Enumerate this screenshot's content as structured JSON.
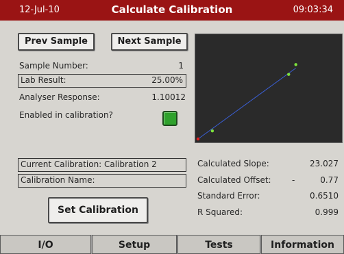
{
  "header": {
    "date": "12-Jul-10",
    "title": "Calculate Calibration",
    "time": "09:03:34"
  },
  "buttons": {
    "prev": "Prev Sample",
    "next": "Next Sample",
    "set": "Set Calibration"
  },
  "sample": {
    "number_label": "Sample Number:",
    "number_value": "1",
    "lab_label": "Lab Result:",
    "lab_value": "25.00%",
    "response_label": "Analyser Response:",
    "response_value": "1.10012",
    "enabled_label": "Enabled in calibration?",
    "enabled": true
  },
  "calibration": {
    "current": "Current Calibration: Calibration 2",
    "name_label": "Calibration Name:"
  },
  "stats": [
    {
      "label": "Calculated Slope:",
      "sign": "",
      "value": "23.027"
    },
    {
      "label": "Calculated Offset:",
      "sign": "-",
      "value": "0.77"
    },
    {
      "label": "Standard Error:",
      "sign": "",
      "value": "0.6510"
    },
    {
      "label": "R Squared:",
      "sign": "",
      "value": "0.999"
    }
  ],
  "tabs": [
    "I/O",
    "Setup",
    "Tests",
    "Information"
  ],
  "colors": {
    "titlebar": "#9a1414",
    "plot_bg": "#2a2a2a",
    "fit_line": "#3a5fd6",
    "point": "#7ee23c",
    "current_point": "#e02020",
    "led_on": "#2fa12c"
  },
  "chart_data": {
    "type": "scatter",
    "points": [
      {
        "x": 0.0,
        "y": 0.0,
        "current": true
      },
      {
        "x": 0.12,
        "y": 0.09
      },
      {
        "x": 0.76,
        "y": 0.72
      },
      {
        "x": 0.82,
        "y": 0.83
      }
    ],
    "fit_line": {
      "from": [
        0.0,
        0.0
      ],
      "to": [
        0.82,
        0.79
      ]
    },
    "xlim": [
      0,
      1
    ],
    "ylim": [
      0,
      1
    ],
    "grid": false
  }
}
